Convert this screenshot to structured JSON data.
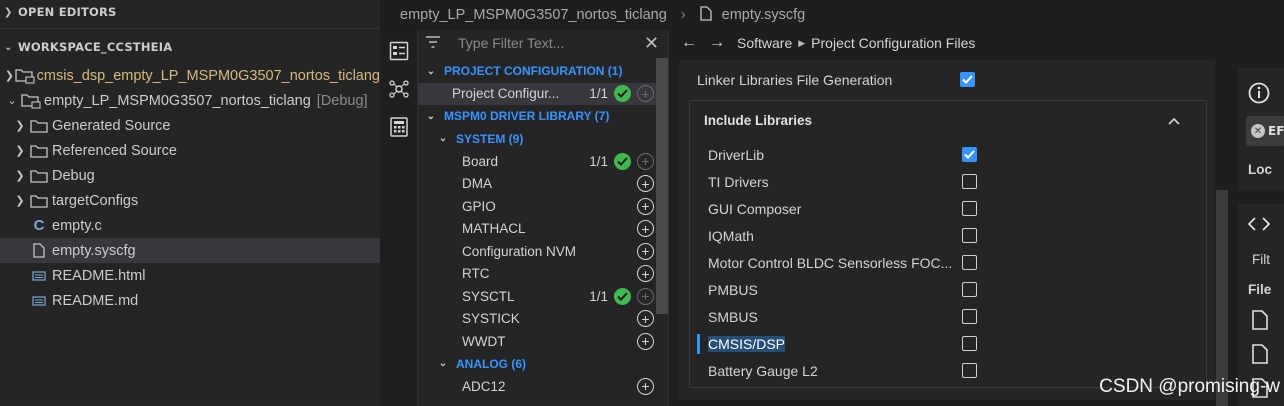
{
  "explorer": {
    "open_editors_label": "OPEN EDITORS",
    "workspace_label": "WORKSPACE_CCSTHEIA",
    "tree": [
      {
        "label": "cmsis_dsp_empty_LP_MSPM0G3507_nortos_ticlang",
        "kind": "project",
        "expanded": false,
        "color": "#d7ba7d"
      },
      {
        "label": "empty_LP_MSPM0G3507_nortos_ticlang",
        "kind": "project",
        "expanded": true,
        "suffix": "[Debug]"
      },
      {
        "label": "Generated Source",
        "kind": "folder"
      },
      {
        "label": "Referenced Source",
        "kind": "folder"
      },
      {
        "label": "Debug",
        "kind": "folder"
      },
      {
        "label": "targetConfigs",
        "kind": "folder"
      },
      {
        "label": "empty.c",
        "kind": "c-file"
      },
      {
        "label": "empty.syscfg",
        "kind": "file",
        "selected": true
      },
      {
        "label": "README.html",
        "kind": "doc"
      },
      {
        "label": "README.md",
        "kind": "doc"
      }
    ]
  },
  "breadcrumb": {
    "project": "empty_LP_MSPM0G3507_nortos_ticlang",
    "file": "empty.syscfg"
  },
  "config_tree": {
    "filter_placeholder": "Type Filter Text...",
    "rows": [
      {
        "label": "PROJECT CONFIGURATION (1)",
        "type": "cat",
        "level": 0
      },
      {
        "label": "Project Configur...",
        "type": "item",
        "level": 1,
        "count": "1/1",
        "ok": true,
        "selected": true
      },
      {
        "label": "MSPM0 DRIVER LIBRARY (7)",
        "type": "cat",
        "level": 0
      },
      {
        "label": "SYSTEM (9)",
        "type": "cat",
        "level": 1
      },
      {
        "label": "Board",
        "type": "item",
        "level": 2,
        "count": "1/1",
        "ok": true
      },
      {
        "label": "DMA",
        "type": "item",
        "level": 2
      },
      {
        "label": "GPIO",
        "type": "item",
        "level": 2
      },
      {
        "label": "MATHACL",
        "type": "item",
        "level": 2
      },
      {
        "label": "Configuration NVM",
        "type": "item",
        "level": 2
      },
      {
        "label": "RTC",
        "type": "item",
        "level": 2
      },
      {
        "label": "SYSCTL",
        "type": "item",
        "level": 2,
        "count": "1/1",
        "ok": true
      },
      {
        "label": "SYSTICK",
        "type": "item",
        "level": 2
      },
      {
        "label": "WWDT",
        "type": "item",
        "level": 2
      },
      {
        "label": "ANALOG (6)",
        "type": "cat",
        "level": 1
      },
      {
        "label": "ADC12",
        "type": "item",
        "level": 2
      }
    ]
  },
  "main": {
    "nav": {
      "software": "Software",
      "page": "Project Configuration Files"
    },
    "linker_label": "Linker Libraries File Generation",
    "linker_checked": true,
    "include_title": "Include Libraries",
    "libraries": [
      {
        "label": "DriverLib",
        "checked": true
      },
      {
        "label": "TI Drivers",
        "checked": false
      },
      {
        "label": "GUI Composer",
        "checked": false
      },
      {
        "label": "IQMath",
        "checked": false
      },
      {
        "label": "Motor Control BLDC Sensorless FOC...",
        "checked": false
      },
      {
        "label": "PMBUS",
        "checked": false
      },
      {
        "label": "SMBUS",
        "checked": false
      },
      {
        "label": "CMSIS/DSP",
        "checked": false,
        "highlighted": true
      },
      {
        "label": "Battery Gauge L2",
        "checked": false
      }
    ]
  },
  "right_panel": {
    "btn_text": "EF",
    "loc_text": "Loc",
    "filt_text": "Filt",
    "file_text": "File"
  },
  "watermark": "CSDN @promising-w",
  "colors": {
    "accent": "#3794ff",
    "ok": "#3fb950",
    "project_yellow": "#d7ba7d"
  }
}
